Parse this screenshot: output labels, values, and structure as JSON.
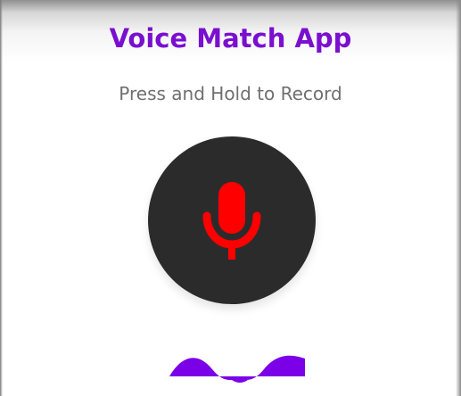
{
  "app": {
    "title": "Voice Match App",
    "subtitle": "Press and Hold to Record"
  },
  "record_button": {
    "icon": "microphone-icon",
    "icon_color": "#ff0000",
    "background_color": "#2c2b2c"
  },
  "waveform": {
    "color": "#7b00e8"
  },
  "colors": {
    "accent": "#7a0fd0",
    "subtitle": "#6f6f6f"
  }
}
